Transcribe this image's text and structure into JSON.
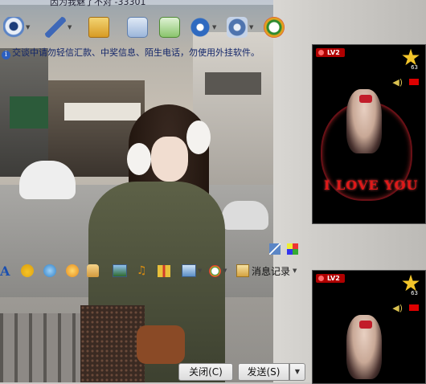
{
  "window": {
    "title_fragment": "因为我魅了不对 -33301"
  },
  "notice": {
    "text": "交谈中请勿轻信汇款、中奖信息、陌生电话，勿使用外挂软件。"
  },
  "toolbar": {
    "buttons": [
      {
        "icon": "video-call-icon"
      },
      {
        "icon": "voice-call-icon"
      },
      {
        "icon": "send-file-icon"
      },
      {
        "icon": "send-mail-icon"
      },
      {
        "icon": "create-group-icon"
      },
      {
        "icon": "app-menu-icon"
      },
      {
        "icon": "settings-icon"
      },
      {
        "icon": "soso-icon"
      }
    ]
  },
  "input_toolbar": {
    "font_label": "A",
    "history_label": "消息记录"
  },
  "side_ads": [
    {
      "level": "LV2",
      "star_count": "63",
      "caption": "I LOVE YOU"
    },
    {
      "level": "LV2",
      "star_count": "63",
      "caption": ""
    }
  ],
  "actions": {
    "close_label": "关闭(C)",
    "send_label": "发送(S)"
  },
  "colors": {
    "notice_text": "#13266a",
    "ad_red": "#b00000",
    "star": "#f3c52a"
  }
}
